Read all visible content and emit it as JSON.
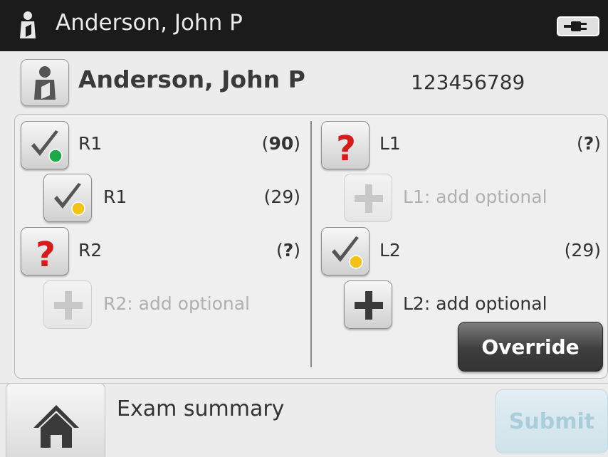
{
  "titlebar": {
    "patient_name": "Anderson, John P",
    "icons": [
      "person-icon",
      "power-plug-icon"
    ]
  },
  "patient": {
    "name": "Anderson, John P",
    "id": "123456789"
  },
  "right": {
    "r1_main": {
      "label": "R1",
      "value": "90",
      "status": "complete-green"
    },
    "r1_sub": {
      "label": "R1",
      "value": "(29)",
      "status": "complete-yellow"
    },
    "r2_main": {
      "label": "R2",
      "value": "?",
      "status": "unknown"
    },
    "r2_optional": {
      "label": "R2: add optional",
      "enabled": false
    }
  },
  "left": {
    "l1_main": {
      "label": "L1",
      "value": "?",
      "status": "unknown"
    },
    "l1_optional": {
      "label": "L1: add optional",
      "enabled": false
    },
    "l2_main": {
      "label": "L2",
      "value": "(29)",
      "status": "complete-yellow"
    },
    "l2_optional": {
      "label": "L2: add optional",
      "enabled": true
    }
  },
  "actions": {
    "override_label": "Override",
    "submit_label": "Submit",
    "submit_enabled": false
  },
  "footer": {
    "summary_label": "Exam summary"
  },
  "colors": {
    "titlebar_bg": "#1b1b1b",
    "status_green": "#1fa84a",
    "status_yellow": "#f2c21b",
    "question_red": "#d41c1c",
    "submit_disabled": "#a9cdda"
  }
}
